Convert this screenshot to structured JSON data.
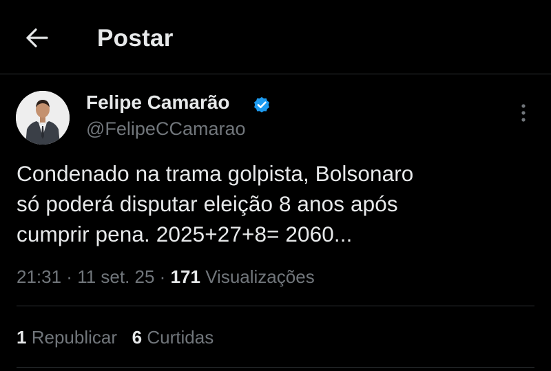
{
  "header": {
    "title": "Postar",
    "back_icon": "arrow-left-icon"
  },
  "post": {
    "author": {
      "name": "Felipe Camarão",
      "handle": "@FelipeCCamarao",
      "verified_icon": "verified-badge-icon",
      "verified_color": "#1d9bf0"
    },
    "text_lines": [
      "Condenado na trama golpista, Bolsonaro",
      "só poderá disputar eleição 8 anos após",
      "cumprir pena. 2025+27+8= 2060..."
    ],
    "time": "21:31",
    "date": "11 set. 25",
    "separator": " · ",
    "views_count": "171",
    "views_label": "Visualizações",
    "reposts_count": "1",
    "reposts_label": "Republicar",
    "likes_count": "6",
    "likes_label": "Curtidas",
    "more_icon": "more-vertical-icon"
  },
  "colors": {
    "background": "#000000",
    "text": "#e7e9ea",
    "secondary": "#71767b",
    "divider": "#2f3336"
  }
}
